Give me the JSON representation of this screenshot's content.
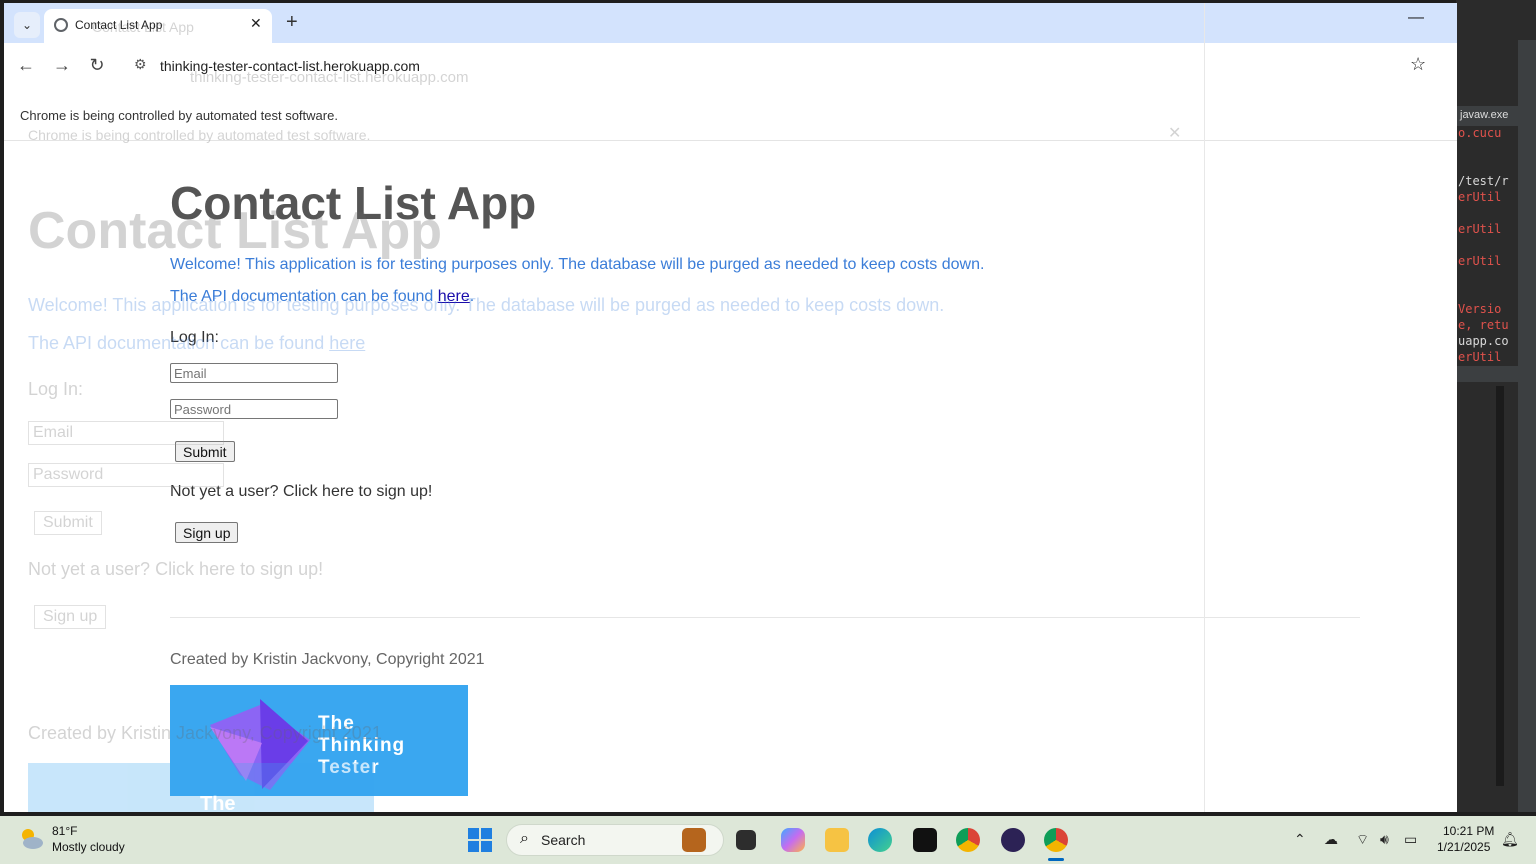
{
  "browser": {
    "tab_title": "Contact List App",
    "tab_close": "✕",
    "new_tab": "+",
    "url": "thinking-tester-contact-list.herokuapp.com",
    "infobar_text": "Chrome is being controlled by automated test software."
  },
  "page": {
    "title": "Contact List App",
    "welcome": "Welcome! This application is for testing purposes only. The database will be purged as needed to keep costs down.",
    "api_prefix": "The API documentation can be found ",
    "api_link": "here",
    "api_suffix": ".",
    "login_label": "Log In:",
    "email_placeholder": "Email",
    "password_placeholder": "Password",
    "submit_label": "Submit",
    "signup_prompt": "Not yet a user? Click here to sign up!",
    "signup_label": "Sign up",
    "footer": "Created by Kristin Jackvony, Copyright 2021",
    "logo_line1": "The",
    "logo_line2": "Thinking",
    "logo_line3": "Tester"
  },
  "ghost": {
    "tab_title": "Contact List App",
    "url": "thinking-tester-contact-list.herokuapp.com",
    "infobar_text": "Chrome is being controlled by automated test software.",
    "title": "Contact List App",
    "welcome": "Welcome! This application is for testing purposes only. The database will be purged as needed to keep costs down.",
    "api_prefix": "The API documentation can be found ",
    "api_link": "here",
    "login_label": "Log In:",
    "email_placeholder": "Email",
    "password_placeholder": "Password",
    "submit_label": "Submit",
    "signup_prompt": "Not yet a user? Click here to sign up!",
    "signup_label": "Sign up",
    "footer": "Created by Kristin Jackvony, Copyright 2021",
    "logo_line1": "The"
  },
  "ide": {
    "lines": [
      {
        "text": "o.cucu",
        "cls": "red"
      },
      {
        "text": "/test/r",
        "cls": "white"
      },
      {
        "text": "erUtil",
        "cls": "red"
      },
      {
        "text": "erUtil",
        "cls": "red"
      },
      {
        "text": "erUtil",
        "cls": "red"
      },
      {
        "text": "Versio",
        "cls": "red"
      },
      {
        "text": "e, retu",
        "cls": "red"
      },
      {
        "text": "uapp.co",
        "cls": "white"
      },
      {
        "text": "erUtil",
        "cls": "red"
      }
    ],
    "process_tab": "javaw.exe"
  },
  "taskbar": {
    "temperature": "81°F",
    "weather": "Mostly cloudy",
    "search_label": "Search",
    "time": "10:21 PM",
    "date": "1/21/2025"
  },
  "colors": {
    "chrome_titlebar": "#d3e3fd",
    "link_blue": "#3b7dd8",
    "logo_bg": "#3aa7f0",
    "taskbar_bg": "#dde7d8"
  }
}
